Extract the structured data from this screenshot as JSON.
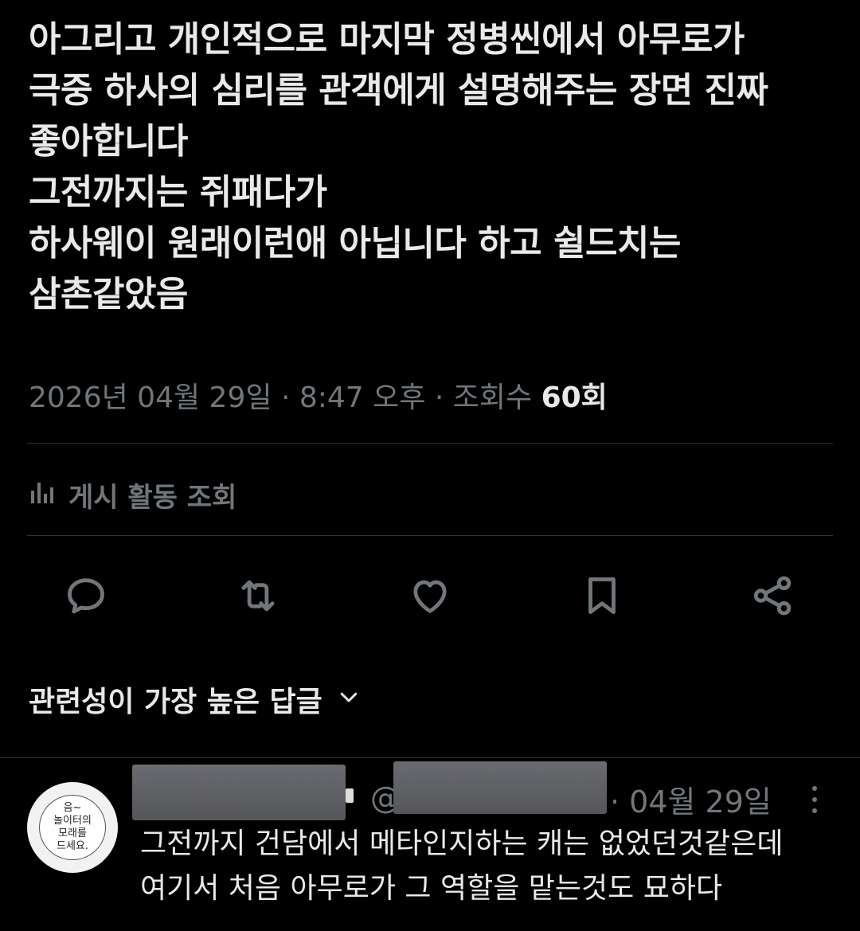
{
  "post": {
    "lines": [
      "아그리고 개인적으로 마지막 정병씬에서 아무로가",
      "극중 하사의 심리를 관객에게 설명해주는 장면 진짜",
      "좋아합니다",
      "그전까지는 쥐패다가",
      "하사웨이 원래이런애 아닙니다 하고 쉴드치는",
      "삼촌같았음"
    ],
    "date": "2026년 04월 29일",
    "time": "8:47 오후",
    "views_label": "조회수",
    "views_count": "60회",
    "separator": "·"
  },
  "activity": {
    "label": "게시 활동 조회",
    "icon": "analytics-bars-icon"
  },
  "actions": [
    {
      "name": "reply",
      "icon": "speech-bubble-icon"
    },
    {
      "name": "retweet",
      "icon": "retweet-arrows-icon"
    },
    {
      "name": "like",
      "icon": "heart-icon"
    },
    {
      "name": "bookmark",
      "icon": "bookmark-icon"
    },
    {
      "name": "share",
      "icon": "share-nodes-icon"
    }
  ],
  "sort": {
    "label": "관련성이 가장 높은 답글",
    "icon": "chevron-down-icon"
  },
  "reply": {
    "avatar_text": [
      "음~",
      "놀이터의",
      "모래를",
      "드세요."
    ],
    "handle_prefix": "@",
    "date": "· 04월 29일",
    "lines": [
      "그전까지 건담에서 메타인지하는 캐는 없었던것같은데",
      "여기서 처음 아무로가 그 역할을 맡는것도 묘하다"
    ]
  },
  "colors": {
    "background": "#000000",
    "text": "#e7e9ea",
    "muted": "#71767b",
    "divider": "#2f3336"
  }
}
